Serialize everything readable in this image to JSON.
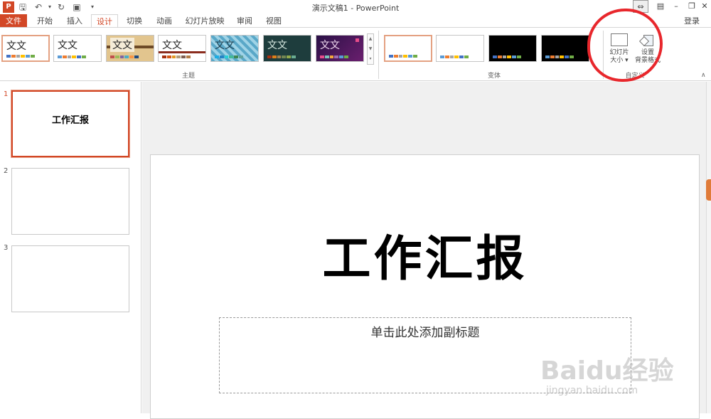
{
  "titlebar": {
    "title": "演示文稿1 - PowerPoint",
    "quick_access": [
      "powerpoint-icon",
      "save-icon",
      "undo-icon",
      "redo-icon",
      "present-icon",
      "customize-icon"
    ]
  },
  "tabs": {
    "file": "文件",
    "items": [
      "开始",
      "插入",
      "设计",
      "切换",
      "动画",
      "幻灯片放映",
      "审阅",
      "视图"
    ],
    "active": "设计",
    "login": "登录"
  },
  "ribbon": {
    "themes_group_label": "主题",
    "variants_group_label": "变体",
    "custom_group_label": "自定义",
    "theme_sample_text": "文文",
    "slide_size_label_line1": "幻灯片",
    "slide_size_label_line2": "大小",
    "format_bg_label_line1": "设置",
    "format_bg_label_line2": "背景格式"
  },
  "slides_pane": {
    "slides": [
      {
        "number": "1",
        "title": "工作汇报"
      },
      {
        "number": "2",
        "title": ""
      },
      {
        "number": "3",
        "title": ""
      }
    ]
  },
  "slide": {
    "title": "工作汇报",
    "subtitle_placeholder": "单击此处添加副标题"
  },
  "watermark": {
    "text": "Baidu经验",
    "sub": "jingyan.baidu.com"
  },
  "colors": {
    "accent": "#d24726",
    "annotation": "#e8272c"
  }
}
